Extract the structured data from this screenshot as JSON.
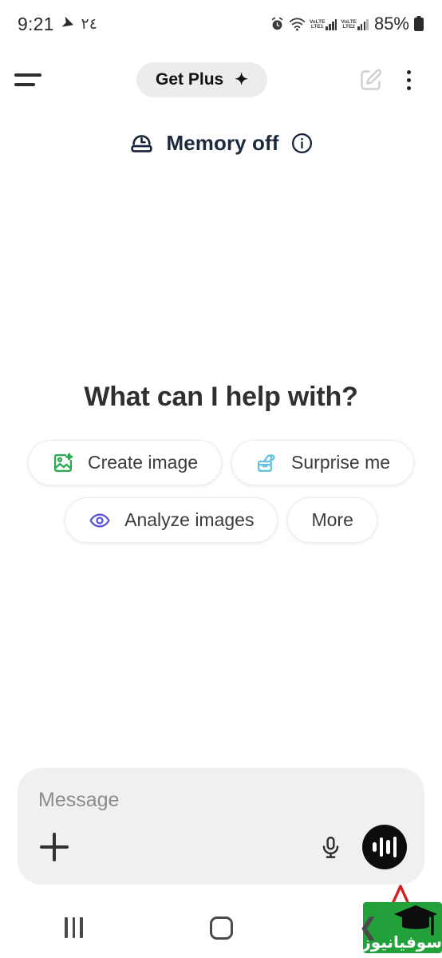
{
  "statusbar": {
    "time": "9:21",
    "nav_arrow_icon": "location-arrow-icon",
    "secondary_text": "٢٤",
    "alarm_icon": "alarm-icon",
    "wifi_icon": "wifi-icon",
    "sim1_label_top": "VoLTE",
    "sim1_label_bottom": "LTE1",
    "sim2_label_top": "VoLTE",
    "sim2_label_bottom": "LTE2",
    "battery_percent": "85%",
    "battery_icon": "battery-icon"
  },
  "appbar": {
    "menu_icon": "hamburger-menu-icon",
    "get_plus_label": "Get Plus",
    "get_plus_sparkle": "✦",
    "compose_icon": "compose-edit-icon",
    "overflow_icon": "kebab-menu-icon"
  },
  "memory": {
    "icon": "memory-icon",
    "label": "Memory off",
    "info_icon": "info-circle-icon"
  },
  "main": {
    "heading": "What can I help with?",
    "chip_rows": [
      [
        {
          "label": "Create image",
          "icon": "create-image-icon",
          "color": "#2dab54"
        },
        {
          "label": "Surprise me",
          "icon": "surprise-gift-icon",
          "color": "#66c2e0"
        }
      ],
      [
        {
          "label": "Analyze images",
          "icon": "eye-icon",
          "color": "#5b57dd"
        },
        {
          "label": "More",
          "icon": "",
          "color": ""
        }
      ]
    ]
  },
  "composer": {
    "placeholder": "Message",
    "value": "",
    "add_icon": "plus-icon",
    "mic_icon": "microphone-icon",
    "voice_icon": "voice-waveform-icon"
  },
  "annotation": {
    "arrow_icon": "red-arrow-up-icon",
    "arrow_color": "#d32020"
  },
  "watermark": {
    "text": "سوفیانیوز",
    "cap_icon": "graduation-cap-icon",
    "bg_color": "#22a13a"
  },
  "navbar": {
    "recents_icon": "recents-icon",
    "home_icon": "home-icon",
    "back_icon": "back-icon"
  }
}
